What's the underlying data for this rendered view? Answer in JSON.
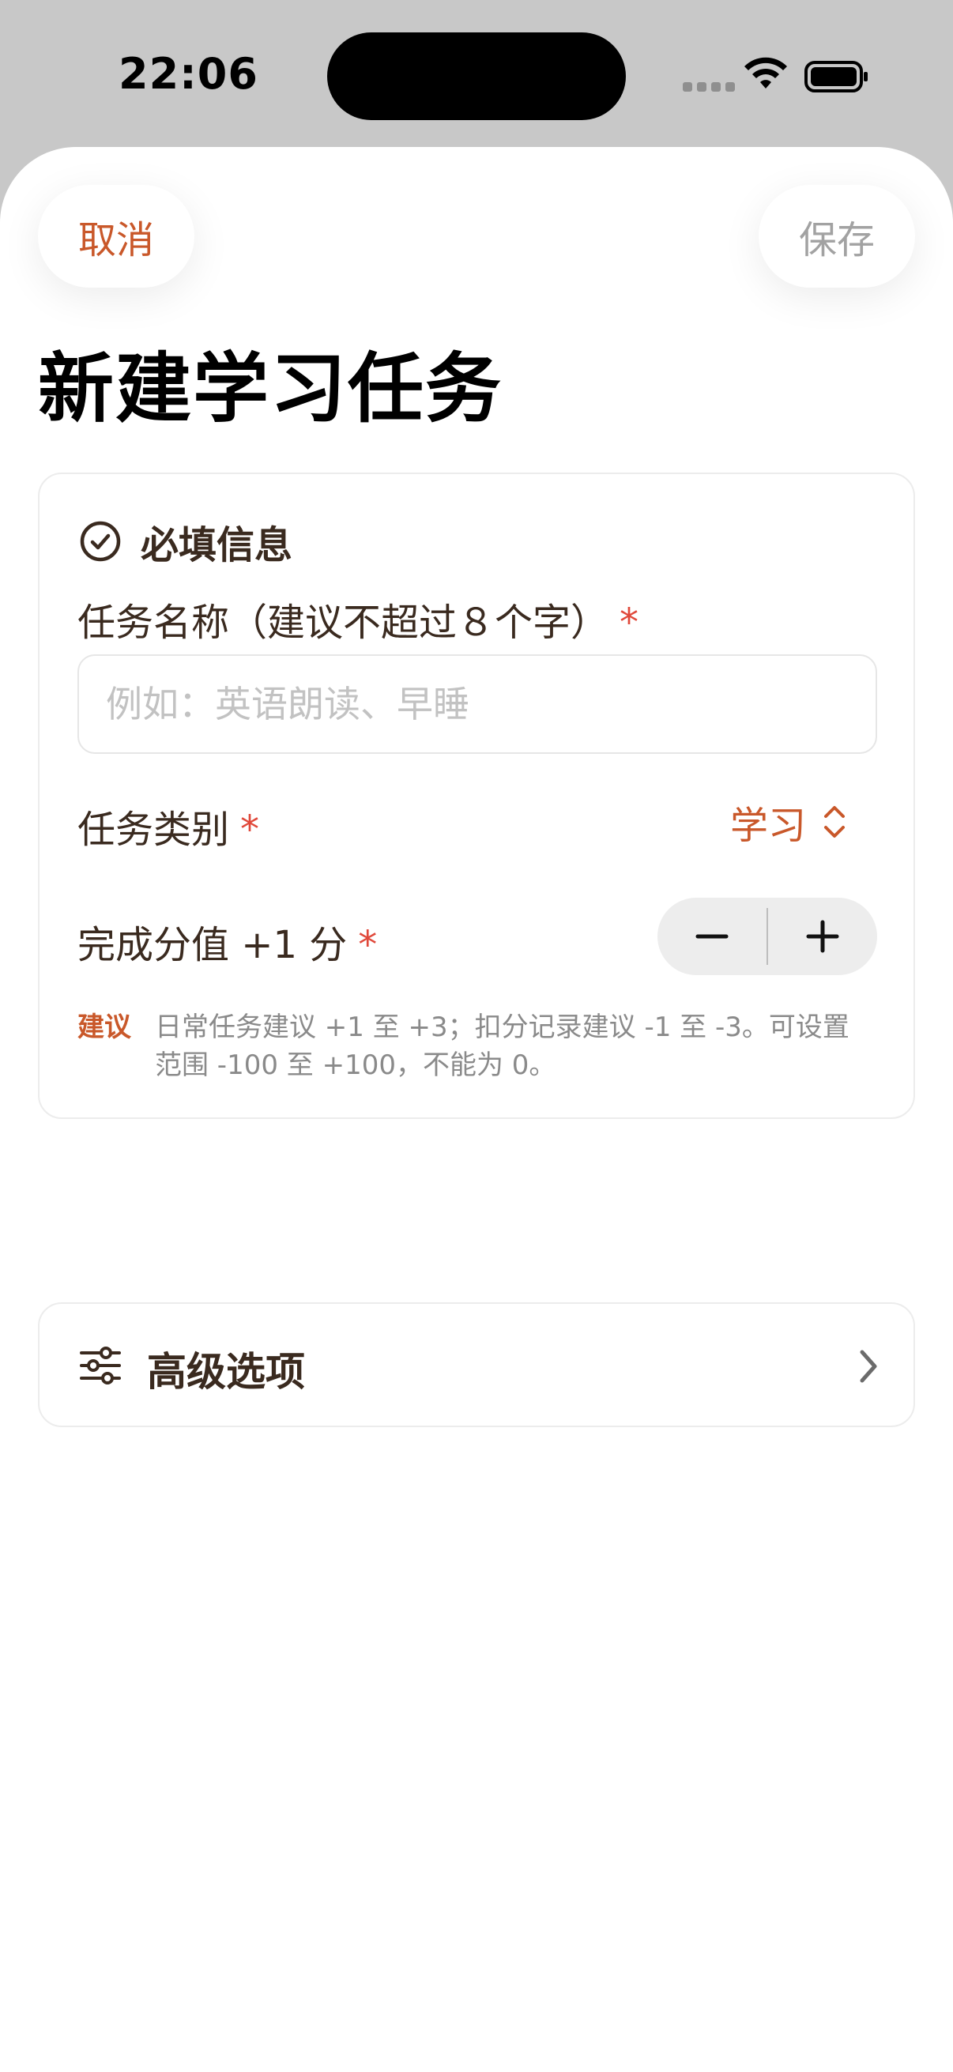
{
  "status_bar": {
    "time": "22:06"
  },
  "nav": {
    "cancel_label": "取消",
    "save_label": "保存"
  },
  "page": {
    "title": "新建学习任务"
  },
  "required_section": {
    "title": "必填信息",
    "name_field": {
      "label": "任务名称（建议不超过８个字）",
      "required_mark": "*",
      "placeholder": "例如：英语朗读、早睡",
      "value": ""
    },
    "category_field": {
      "label": "任务类别",
      "required_mark": "*",
      "selected_value": "学习"
    },
    "points_field": {
      "label": "完成分值 +1 分",
      "required_mark": "*",
      "decrement_icon": "minus-icon",
      "increment_icon": "plus-icon"
    },
    "hint": {
      "tag": "建议",
      "text": "日常任务建议 +1 至 +3；扣分记录建议 -1 至 -3。可设置范围 -100 至 +100，不能为 0。"
    }
  },
  "advanced_section": {
    "label": "高级选项",
    "icon": "sliders-icon"
  },
  "colors": {
    "accent": "#c9582a",
    "required_star": "#e0483a",
    "text_primary": "#3a2a1f",
    "muted": "#a2a2a2"
  }
}
